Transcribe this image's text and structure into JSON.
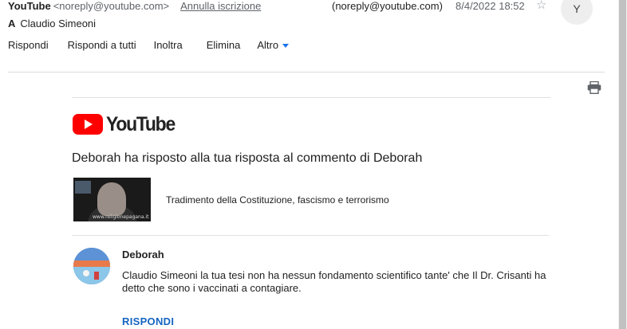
{
  "header": {
    "sender_name": "YouTube",
    "sender_email": "<noreply@youtube.com>",
    "unsubscribe": "Annulla iscrizione",
    "reply_to": "(noreply@youtube.com)",
    "date": "8/4/2022 18:52",
    "star_glyph": "☆",
    "avatar_letter": "Y",
    "to_label": "A",
    "to_name": "Claudio Simeoni"
  },
  "toolbar": {
    "reply": "Rispondi",
    "reply_all": "Rispondi a tutti",
    "forward": "Inoltra",
    "delete": "Elimina",
    "more": "Altro"
  },
  "email": {
    "logo_text": "YouTube",
    "headline": "Deborah ha risposto alla tua risposta al commento di Deborah",
    "video_title": "Tradimento della Costituzione, fascismo e terrorismo",
    "video_caption": "www.religionepagana.it",
    "comment_author": "Deborah",
    "comment_text": "Claudio Simeoni la tua tesi non ha nessun fondamento scientifico tante' che Il Dr. Crisanti ha detto che sono i vaccinati a contagiare.",
    "reply_link": "RISPONDI"
  },
  "colors": {
    "youtube_red": "#ff0000",
    "link_blue": "#1565c0",
    "caret_blue": "#1a73e8"
  }
}
